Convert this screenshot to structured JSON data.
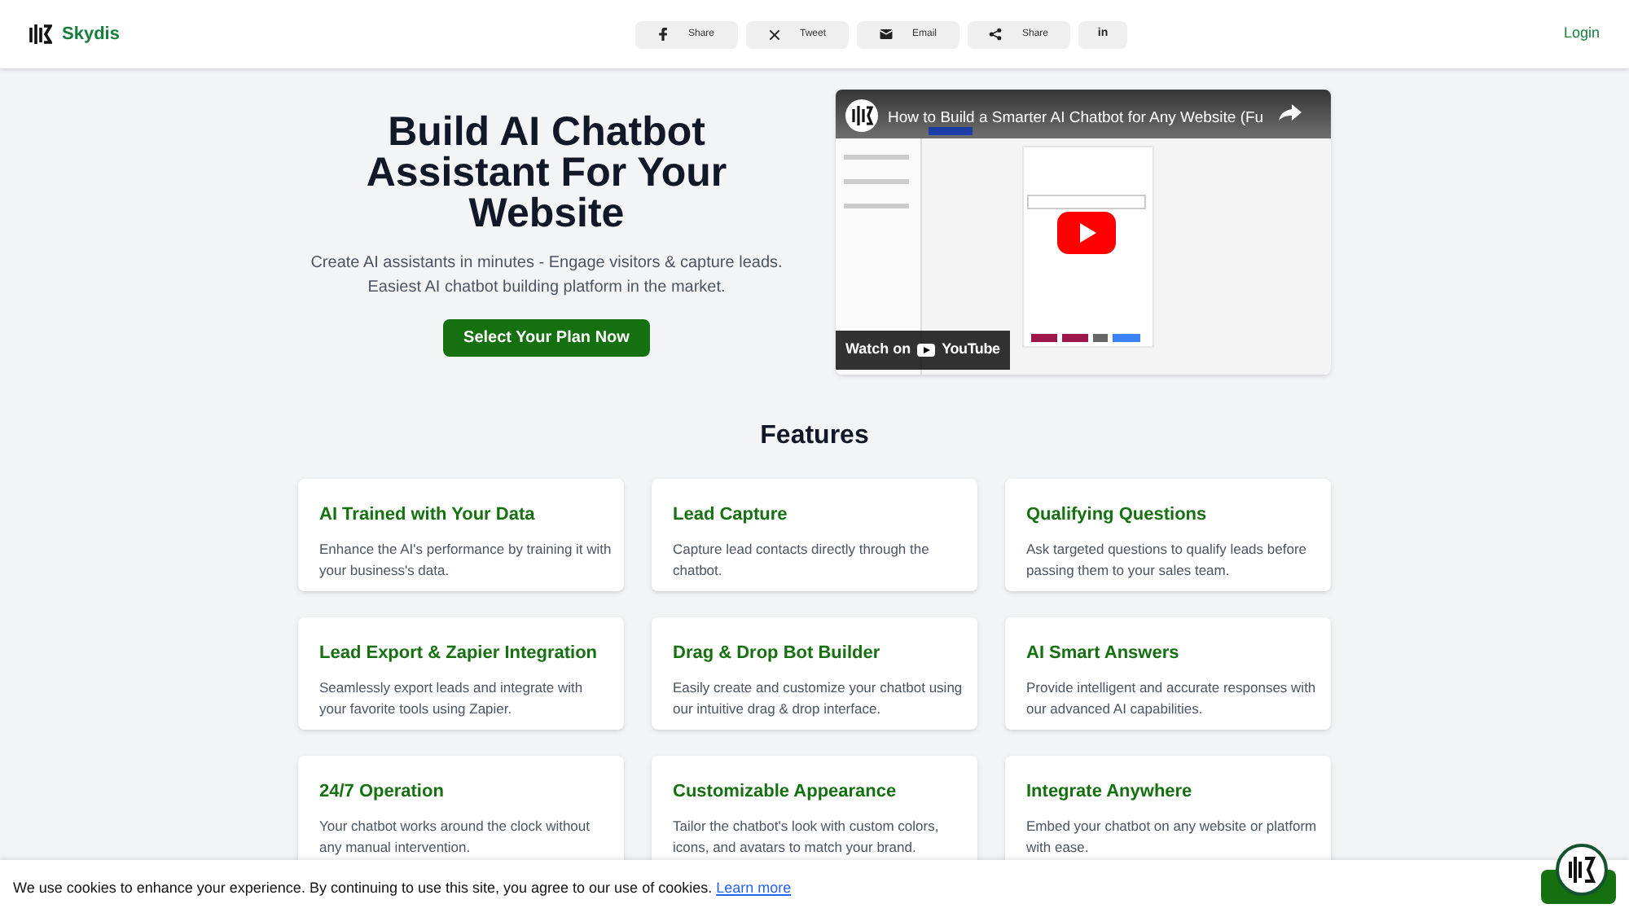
{
  "header": {
    "brand": "Skydis",
    "share_buttons": [
      {
        "kind": "facebook",
        "label": "Share"
      },
      {
        "kind": "x",
        "label": "Tweet"
      },
      {
        "kind": "email",
        "label": "Email"
      },
      {
        "kind": "share",
        "label": "Share"
      },
      {
        "kind": "linkedin",
        "label": "in"
      }
    ],
    "login": "Login"
  },
  "hero": {
    "title": "Build AI Chatbot Assistant For Your Website",
    "subtitle": "Create AI assistants in minutes - Engage visitors & capture leads. Easiest AI chatbot building platform in the market.",
    "cta": "Select Your Plan Now",
    "video": {
      "title": "How to Build a Smarter AI Chatbot for Any Website (Fu",
      "watch_on": "Watch on",
      "platform": "YouTube"
    }
  },
  "features": {
    "heading": "Features",
    "items": [
      {
        "title": "AI Trained with Your Data",
        "text": "Enhance the AI's performance by training it with your business's data."
      },
      {
        "title": "Lead Capture",
        "text": "Capture lead contacts directly through the chatbot."
      },
      {
        "title": "Qualifying Questions",
        "text": "Ask targeted questions to qualify leads before passing them to your sales team."
      },
      {
        "title": "Lead Export & Zapier Integration",
        "text": "Seamlessly export leads and integrate with your favorite tools using Zapier."
      },
      {
        "title": "Drag & Drop Bot Builder",
        "text": "Easily create and customize your chatbot using our intuitive drag & drop interface."
      },
      {
        "title": "AI Smart Answers",
        "text": "Provide intelligent and accurate responses with our advanced AI capabilities."
      },
      {
        "title": "24/7 Operation",
        "text": "Your chatbot works around the clock without any manual intervention."
      },
      {
        "title": "Customizable Appearance",
        "text": "Tailor the chatbot's look with custom colors, icons, and avatars to match your brand."
      },
      {
        "title": "Integrate Anywhere",
        "text": "Embed your chatbot on any website or platform with ease."
      }
    ]
  },
  "cookie_bar": {
    "text": "We use cookies to enhance your experience. By continuing to use this site, you agree to our use of cookies.",
    "link": "Learn more"
  }
}
